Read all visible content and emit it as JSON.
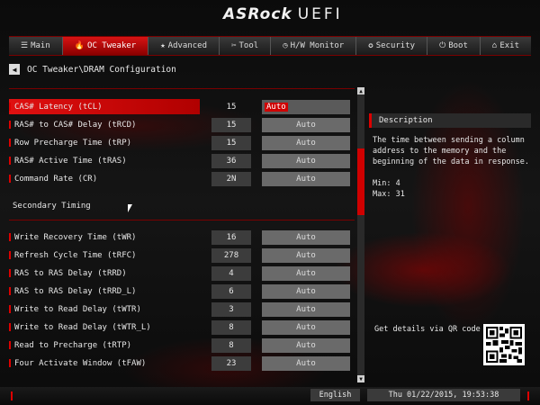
{
  "brand": {
    "logo_main": "ASRock",
    "logo_sub": "UEFI"
  },
  "nav": {
    "tabs": [
      {
        "id": "main",
        "icon": "☰",
        "label": "Main"
      },
      {
        "id": "oc",
        "icon": "🔥",
        "label": "OC Tweaker"
      },
      {
        "id": "adv",
        "icon": "★",
        "label": "Advanced"
      },
      {
        "id": "tool",
        "icon": "✂",
        "label": "Tool"
      },
      {
        "id": "hw",
        "icon": "◷",
        "label": "H/W Monitor"
      },
      {
        "id": "sec",
        "icon": "✪",
        "label": "Security"
      },
      {
        "id": "boot",
        "icon": "⏻",
        "label": "Boot"
      },
      {
        "id": "exit",
        "icon": "⌂",
        "label": "Exit"
      }
    ]
  },
  "breadcrumb": "OC Tweaker\\DRAM Configuration",
  "back_icon": "◀",
  "rows_top": [
    {
      "label": "CAS# Latency (tCL)",
      "value": "15",
      "setting": "Auto"
    },
    {
      "label": "RAS# to CAS# Delay (tRCD)",
      "value": "15",
      "setting": "Auto"
    },
    {
      "label": "Row Precharge Time (tRP)",
      "value": "15",
      "setting": "Auto"
    },
    {
      "label": "RAS# Active Time (tRAS)",
      "value": "36",
      "setting": "Auto"
    },
    {
      "label": "Command Rate (CR)",
      "value": "2N",
      "setting": "Auto"
    }
  ],
  "secondary_title": "Secondary Timing",
  "rows_secondary": [
    {
      "label": "Write Recovery Time (tWR)",
      "value": "16",
      "setting": "Auto"
    },
    {
      "label": "Refresh Cycle Time (tRFC)",
      "value": "278",
      "setting": "Auto"
    },
    {
      "label": "RAS to RAS Delay (tRRD)",
      "value": "4",
      "setting": "Auto"
    },
    {
      "label": "RAS to RAS Delay (tRRD_L)",
      "value": "6",
      "setting": "Auto"
    },
    {
      "label": "Write to Read Delay (tWTR)",
      "value": "3",
      "setting": "Auto"
    },
    {
      "label": "Write to Read Delay (tWTR_L)",
      "value": "8",
      "setting": "Auto"
    },
    {
      "label": "Read to Precharge (tRTP)",
      "value": "8",
      "setting": "Auto"
    },
    {
      "label": "Four Activate Window (tFAW)",
      "value": "23",
      "setting": "Auto"
    }
  ],
  "description": {
    "title": "Description",
    "text": "The time between sending a column address to the memory and the beginning of the data in response.",
    "min": "Min: 4",
    "max": "Max: 31"
  },
  "qr_text": "Get details via QR code",
  "scroll": {
    "up_icon": "▲",
    "down_icon": "▼"
  },
  "footer": {
    "language": "English",
    "datetime": "Thu 01/22/2015, 19:53:38"
  },
  "colors": {
    "accent": "#d00000",
    "panel": "#3c3c3c",
    "auto_box": "#6a6a6a"
  }
}
